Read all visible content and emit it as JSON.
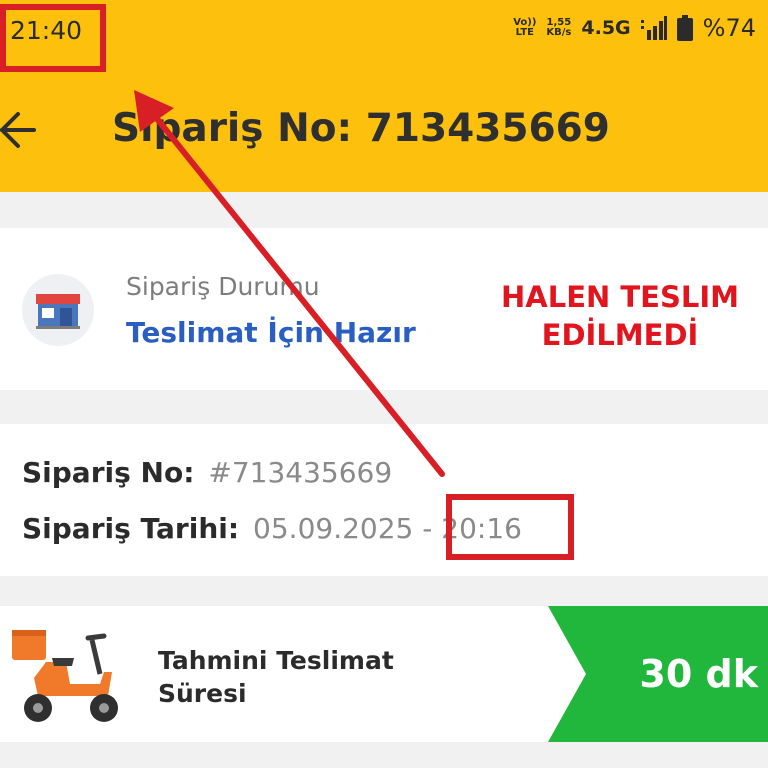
{
  "statusbar": {
    "time": "21:40",
    "volte_top": "Vo))",
    "volte_bottom": "LTE",
    "speed_value": "1,55",
    "speed_unit": "KB/s",
    "network": "4.5G",
    "battery": "%74"
  },
  "appbar": {
    "title": "Sipariş No: 713435669"
  },
  "order_status": {
    "label": "Sipariş Durumu",
    "value": "Teslimat İçin Hazır",
    "stamp_line1": "HALEN TESLIM",
    "stamp_line2": "EDİLMEDİ"
  },
  "order_info": {
    "order_no_label": "Sipariş No:",
    "order_no_value": "#713435669",
    "order_date_label": "Sipariş Tarihi:",
    "order_date_value": "05.09.2025 - 20:16"
  },
  "delivery": {
    "label_line1": "Tahmini Teslimat",
    "label_line2": "Süresi",
    "eta": "30 dk"
  },
  "colors": {
    "header": "#fdc10d",
    "status_blue": "#2a5ec2",
    "stamp_red": "#e2141d",
    "eta_green": "#20b73c",
    "annotation_red": "#d81f26"
  },
  "icons": [
    "back-arrow-icon",
    "store-icon",
    "scooter-icon",
    "signal-icon",
    "battery-icon"
  ]
}
